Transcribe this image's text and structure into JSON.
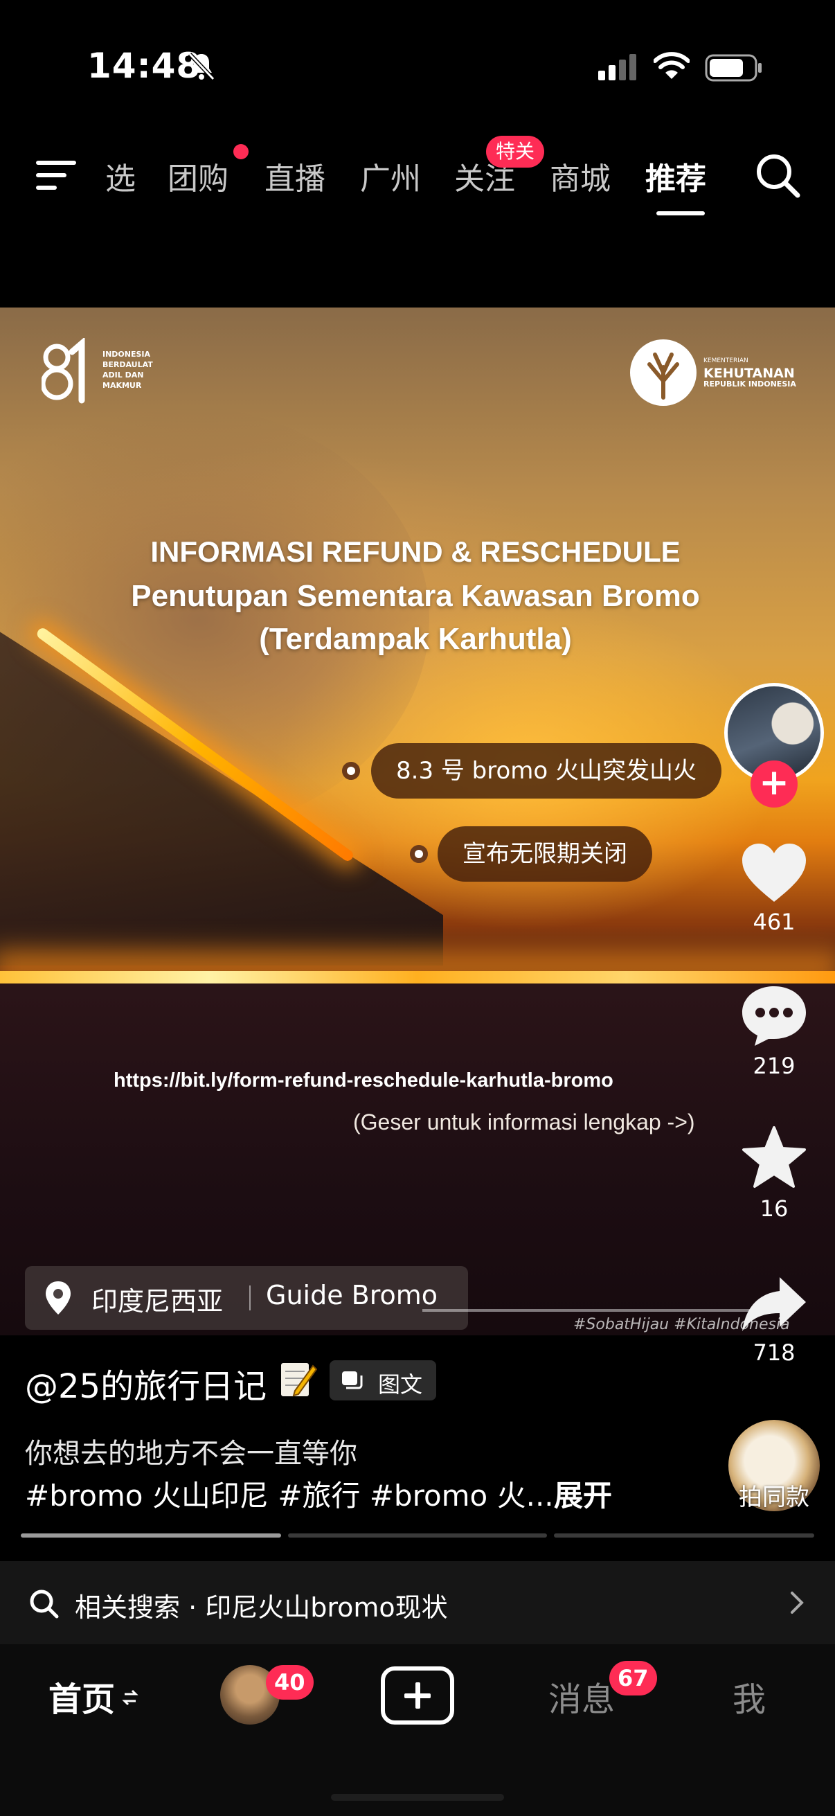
{
  "status_bar": {
    "time": "14:48",
    "icons": [
      "bell-muted-icon",
      "cellular-signal-icon",
      "wifi-icon",
      "battery-icon"
    ]
  },
  "top_nav": {
    "tabs": [
      {
        "label": "选"
      },
      {
        "label": "团购"
      },
      {
        "label": "直播"
      },
      {
        "label": "广州"
      },
      {
        "label": "关注"
      },
      {
        "label": "商城"
      },
      {
        "label": "推荐"
      }
    ],
    "active_tab": "推荐",
    "follow_badge": "特关"
  },
  "video": {
    "logo_81_text": "INDONESIA BERDAULAT ADIL DAN MAKMUR",
    "kehutanan_small": "KEMENTERIAN",
    "kehutanan_big": "KEHUTANAN",
    "kehutanan_sub": "REPUBLIK INDONESIA",
    "headline_1": "INFORMASI REFUND & RESCHEDULE",
    "headline_2": "Penutupan Sementara Kawasan Bromo",
    "headline_3": "(Terdampak Karhutla)",
    "pill_1": "8.3 号 bromo 火山突发山火",
    "pill_2": "宣布无限期关闭",
    "url": "https://bit.ly/form-refund-reschedule-karhutla-bromo",
    "swipe_hint": "(Geser untuk informasi lengkap ->)",
    "hashtag_watermark": "#SobatHijau #KitaIndonesia",
    "location": {
      "place": "印度尼西亚",
      "poi": "Guide Bromo"
    }
  },
  "actions": {
    "likes": "461",
    "comments": "219",
    "favorites": "16",
    "shares": "718"
  },
  "caption": {
    "author": "@25的旅行日记",
    "type_chip": "图文",
    "line1": "你想去的地方不会一直等你",
    "line2": "#bromo 火山印尼 #旅行 #bromo 火...",
    "expand": "展开",
    "same_style": "拍同款"
  },
  "image_pages": {
    "total": 3,
    "current": 1
  },
  "related_search": {
    "label": "相关搜索 · 印尼火山bromo现状"
  },
  "tab_bar": {
    "home": "首页",
    "friends_badge": "40",
    "messages": "消息",
    "messages_badge": "67",
    "me": "我"
  },
  "colors": {
    "accent_red": "#fe2c55",
    "background": "#000000"
  }
}
